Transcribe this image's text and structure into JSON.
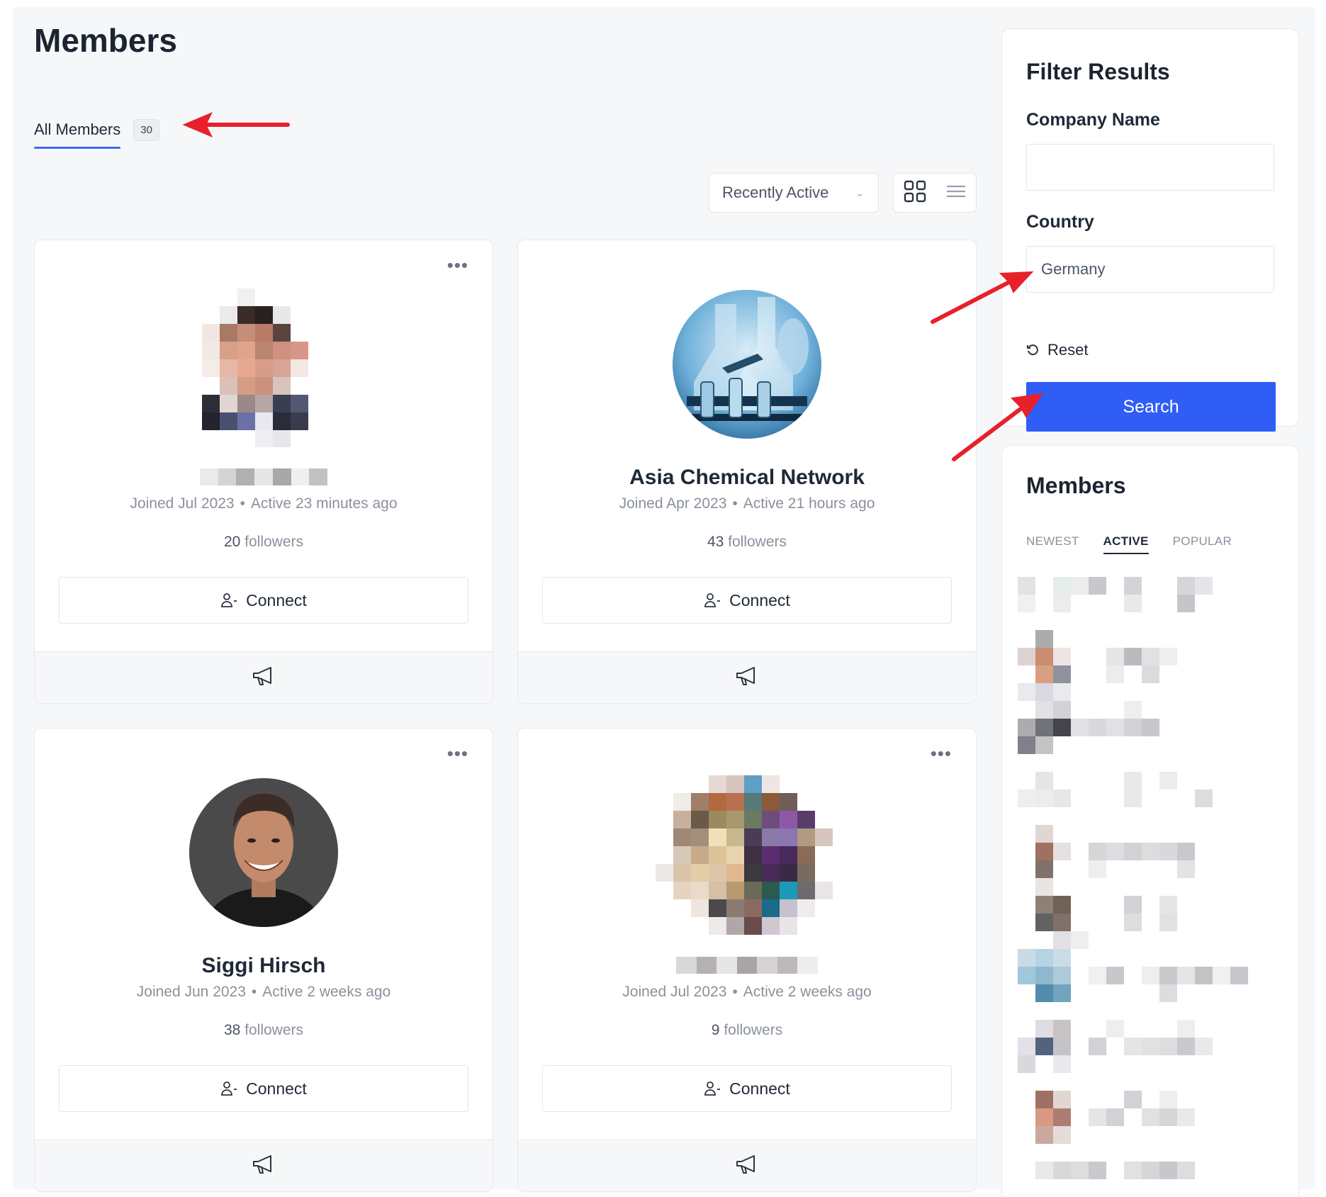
{
  "page": {
    "title": "Members"
  },
  "tabs": [
    {
      "label": "All Members",
      "count": "30"
    }
  ],
  "toolbar": {
    "sort_selected": "Recently Active",
    "grid_icon": "grid-view-icon",
    "list_icon": "list-view-icon"
  },
  "members": [
    {
      "name": "",
      "joined": "Joined Jul 2023",
      "active": "Active 23 minutes ago",
      "followers_count": "20",
      "followers_label": "followers",
      "connect_label": "Connect",
      "avatar": "pixelated-person"
    },
    {
      "name": "Asia Chemical Network",
      "joined": "Joined Apr 2023",
      "active": "Active 21 hours ago",
      "followers_count": "43",
      "followers_label": "followers",
      "connect_label": "Connect",
      "avatar": "lab-glassware"
    },
    {
      "name": "Siggi Hirsch",
      "joined": "Jun 2023",
      "joined_full": "Joined Jun 2023",
      "active": "Active 2 weeks ago",
      "followers_count": "38",
      "followers_label": "followers",
      "connect_label": "Connect",
      "avatar": "smiling-man"
    },
    {
      "name": "",
      "joined": "Joined Jul 2023",
      "active": "Active 2 weeks ago",
      "followers_count": "9",
      "followers_label": "followers",
      "connect_label": "Connect",
      "avatar": "pixelated-group"
    }
  ],
  "filter": {
    "title": "Filter Results",
    "company_label": "Company Name",
    "company_value": "",
    "country_label": "Country",
    "country_value": "Germany",
    "reset_label": "Reset",
    "search_label": "Search"
  },
  "members_widget": {
    "title": "Members",
    "tabs": [
      "NEWEST",
      "ACTIVE",
      "POPULAR"
    ],
    "active_tab": "ACTIVE"
  },
  "colors": {
    "accent": "#2f5df5",
    "tab_underline": "#3b6cf5",
    "annotation_arrow": "#e8202a"
  }
}
